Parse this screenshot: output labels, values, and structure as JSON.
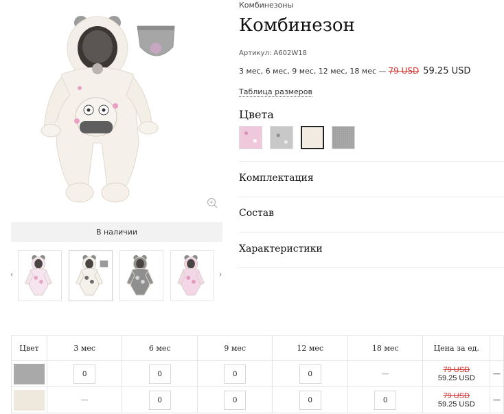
{
  "breadcrumb": "Комбинезоны",
  "product": {
    "title": "Комбинезон",
    "sku": "Артикул: A602W18",
    "sizes_text": "3 мес, 6 мес, 9 мес, 12 мес, 18 мес —",
    "old_price": "79 USD",
    "new_price": "59.25 USD",
    "size_table_link": "Таблица размеров",
    "stock_status": "В наличии"
  },
  "colors": {
    "heading": "Цвета",
    "swatches": [
      {
        "name": "pink-floral",
        "color": "#f0c8dc"
      },
      {
        "name": "grey-pattern",
        "color": "#c8c8c8"
      },
      {
        "name": "cream",
        "color": "#f1ebe1",
        "selected": true
      },
      {
        "name": "grey",
        "color": "#a9a9a9"
      }
    ]
  },
  "sections": [
    {
      "label": "Комплектация"
    },
    {
      "label": "Состав"
    },
    {
      "label": "Характеристики"
    }
  ],
  "gallery": {
    "prev_arrow": "‹",
    "next_arrow": "›",
    "thumbnails": [
      {
        "name": "thumb-pink",
        "body": "#f6e4ef",
        "accent": "#e6a7c7"
      },
      {
        "name": "thumb-cream",
        "body": "#f4f0ea",
        "accent": "#6b6b6b",
        "active": true
      },
      {
        "name": "thumb-grey",
        "body": "#8f8f8f",
        "accent": "#d8d8d8"
      },
      {
        "name": "thumb-pink-2",
        "body": "#f4d7e6",
        "accent": "#e09abd"
      }
    ]
  },
  "order_table": {
    "headers": [
      "Цвет",
      "3 мес",
      "6 мес",
      "9 мес",
      "12 мес",
      "18 мес",
      "Цена за ед."
    ],
    "rows": [
      {
        "swatch_color": "#a9a9a9",
        "cells": [
          "0",
          "0",
          "0",
          "0",
          "—"
        ],
        "old_price": "79 USD",
        "new_price": "59.25 USD",
        "trailing": "—"
      },
      {
        "swatch_color": "#efe8dc",
        "cells": [
          "—",
          "0",
          "0",
          "0",
          "0"
        ],
        "old_price": "79 USD",
        "new_price": "59.25 USD",
        "trailing": "—"
      }
    ]
  },
  "icons": {
    "zoom": "zoom-in-icon",
    "prev": "chevron-left-icon",
    "next": "chevron-right-icon"
  }
}
